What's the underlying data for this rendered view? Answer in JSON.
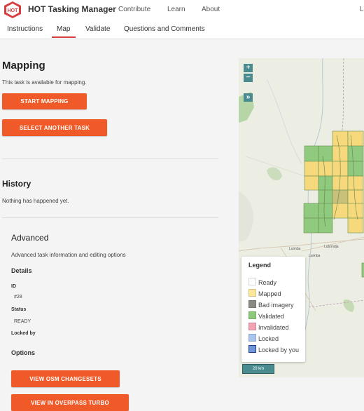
{
  "header": {
    "logo_text": "HOT",
    "brand": "HOT Tasking Manager",
    "nav": [
      "Contribute",
      "Learn",
      "About"
    ],
    "user_initial": "L"
  },
  "tabs": [
    {
      "label": "Instructions",
      "active": false
    },
    {
      "label": "Map",
      "active": true
    },
    {
      "label": "Validate",
      "active": false
    },
    {
      "label": "Questions and Comments",
      "active": false
    }
  ],
  "mapping": {
    "title": "Mapping",
    "status": "This task is available for mapping.",
    "start_button": "START MAPPING",
    "select_button": "SELECT ANOTHER TASK"
  },
  "history": {
    "title": "History",
    "text": "Nothing has happened yet."
  },
  "advanced": {
    "title": "Advanced",
    "subtitle": "Advanced task information and editing options",
    "details_title": "Details",
    "id_label": "ID",
    "id_value": "#28",
    "status_label": "Status",
    "status_value": "READY",
    "locked_by_label": "Locked by",
    "options_title": "Options",
    "osm_button": "VIEW OSM CHANGESETS",
    "overpass_button": "VIEW IN OVERPASS TURBO"
  },
  "map": {
    "zoom_in": "+",
    "zoom_out": "−",
    "layers_toggle": "»",
    "place_labels": [
      "Luimba",
      "Lubondja",
      "Luimba"
    ],
    "scale": "20 km"
  },
  "legend": {
    "title": "Legend",
    "items": [
      {
        "label": "Ready",
        "color": "#fdfdfd"
      },
      {
        "label": "Mapped",
        "color": "#fde79a"
      },
      {
        "label": "Bad imagery",
        "color": "#8a8a82"
      },
      {
        "label": "Validated",
        "color": "#8ec97a"
      },
      {
        "label": "Invalidated",
        "color": "#f2a3b4"
      },
      {
        "label": "Locked",
        "color": "#a9c4ee"
      },
      {
        "label": "Locked by you",
        "color": "#6f95d6"
      }
    ]
  },
  "colors": {
    "accent": "#f05a28",
    "brand_red": "#d73f3f",
    "map_control": "#4a8b8f"
  }
}
